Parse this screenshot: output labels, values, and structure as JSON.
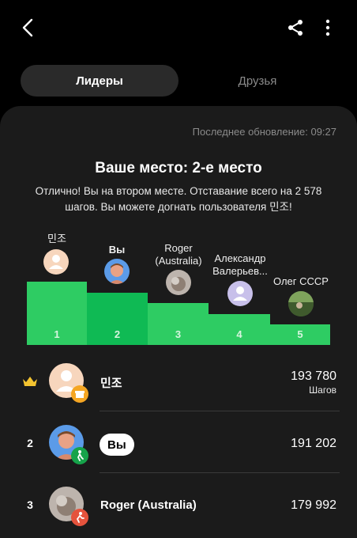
{
  "header": {
    "back_icon": "chevron-left-icon",
    "share_icon": "share-icon",
    "more_icon": "more-vertical-icon"
  },
  "tabs": [
    {
      "label": "Лидеры",
      "active": true
    },
    {
      "label": "Друзья",
      "active": false
    }
  ],
  "panel": {
    "last_update": "Последнее обновление: 09:27",
    "place_title": "Ваше место: 2-е место",
    "place_description": "Отлично! Вы на втором месте. Отставание всего на 2 578 шагов. Вы можете догнать пользователя 민조!"
  },
  "podium": [
    {
      "rank": "1",
      "name": "민조",
      "avatar": "default-user-icon"
    },
    {
      "rank": "2",
      "name": "Вы",
      "avatar": "user-photo-avatar"
    },
    {
      "rank": "3",
      "name": "Roger (Australia)",
      "avatar": "user-photo-avatar"
    },
    {
      "rank": "4",
      "name": "Александр Валерьев...",
      "avatar": "default-user-icon"
    },
    {
      "rank": "5",
      "name": "Олег СССР",
      "avatar": "user-photo-avatar"
    }
  ],
  "leaderboard": [
    {
      "rank_icon": "crown-icon",
      "name": "민조",
      "steps": "193 780",
      "unit": "Шагов",
      "badge": "gift-badge-icon"
    },
    {
      "rank": "2",
      "name": "Вы",
      "steps": "191 202",
      "badge": "walker-badge-icon"
    },
    {
      "rank": "3",
      "name": "Roger (Australia)",
      "steps": "179 992",
      "badge": "runner-badge-icon"
    }
  ],
  "colors": {
    "podium_bar": "#2ecc63",
    "podium_bar_me": "#0fba54",
    "crown": "#f4c430",
    "panel": "#1b1b1b"
  }
}
